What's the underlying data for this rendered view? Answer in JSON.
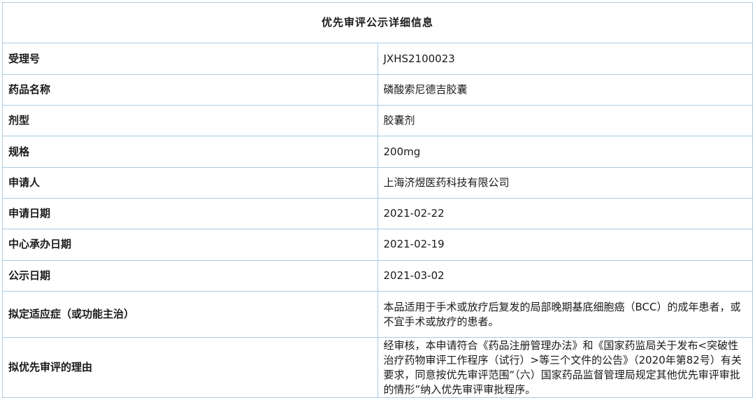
{
  "title": "优先审评公示详细信息",
  "rows": [
    {
      "label": "受理号",
      "value": "JXHS2100023"
    },
    {
      "label": "药品名称",
      "value": "磷酸索尼德吉胶囊"
    },
    {
      "label": "剂型",
      "value": "胶囊剂"
    },
    {
      "label": "规格",
      "value": "200mg"
    },
    {
      "label": "申请人",
      "value": "上海济煜医药科技有限公司"
    },
    {
      "label": "申请日期",
      "value": "2021-02-22"
    },
    {
      "label": "中心承办日期",
      "value": "2021-02-19"
    },
    {
      "label": "公示日期",
      "value": "2021-03-02"
    },
    {
      "label": "拟定适应症（或功能主治）",
      "value": "本品适用于手术或放疗后复发的局部晚期基底细胞癌（BCC）的成年患者，或不宜手术或放疗的患者。"
    },
    {
      "label": "拟优先审评的理由",
      "value": "经审核，本申请符合《药品注册管理办法》和《国家药监局关于发布<突破性治疗药物审评工作程序（试行）>等三个文件的公告》（2020年第82号）有关要求，同意按优先审评范围“（六）国家药品监督管理局规定其他优先审评审批的情形”纳入优先审评审批程序。"
    }
  ]
}
